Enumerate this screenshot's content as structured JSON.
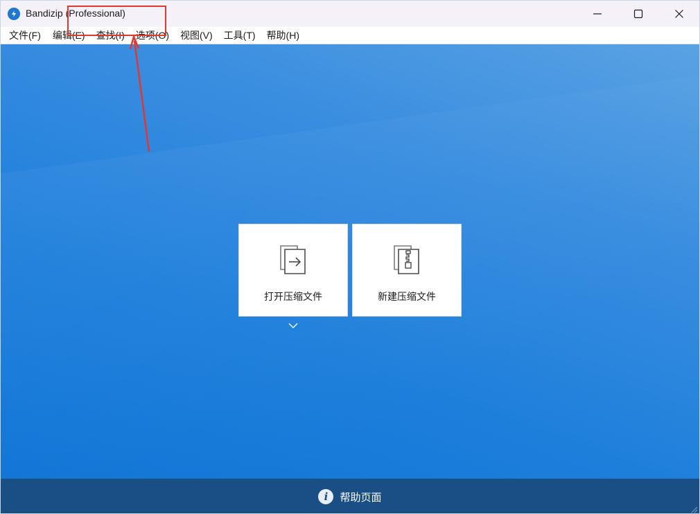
{
  "window": {
    "title": "Bandizip (Professional)",
    "app_icon": "bandizip-logo-icon",
    "controls": [
      "minimize-icon",
      "maximize-icon",
      "close-icon"
    ]
  },
  "menubar": {
    "items": [
      {
        "label": "文件(F)"
      },
      {
        "label": "编辑(E)"
      },
      {
        "label": "查找(I)"
      },
      {
        "label": "选项(O)"
      },
      {
        "label": "视图(V)"
      },
      {
        "label": "工具(T)"
      },
      {
        "label": "帮助(H)"
      }
    ]
  },
  "main": {
    "cards": [
      {
        "label": "打开压缩文件",
        "icon": "open-archive-icon"
      },
      {
        "label": "新建压缩文件",
        "icon": "new-archive-icon"
      }
    ],
    "expand_icon": "chevron-down-icon"
  },
  "footer": {
    "label": "帮助页面",
    "icon": "info-icon"
  },
  "colors": {
    "accent": "#1e7fdb",
    "footer_bg": "#1a4f86",
    "annotation": "#e2372f"
  }
}
